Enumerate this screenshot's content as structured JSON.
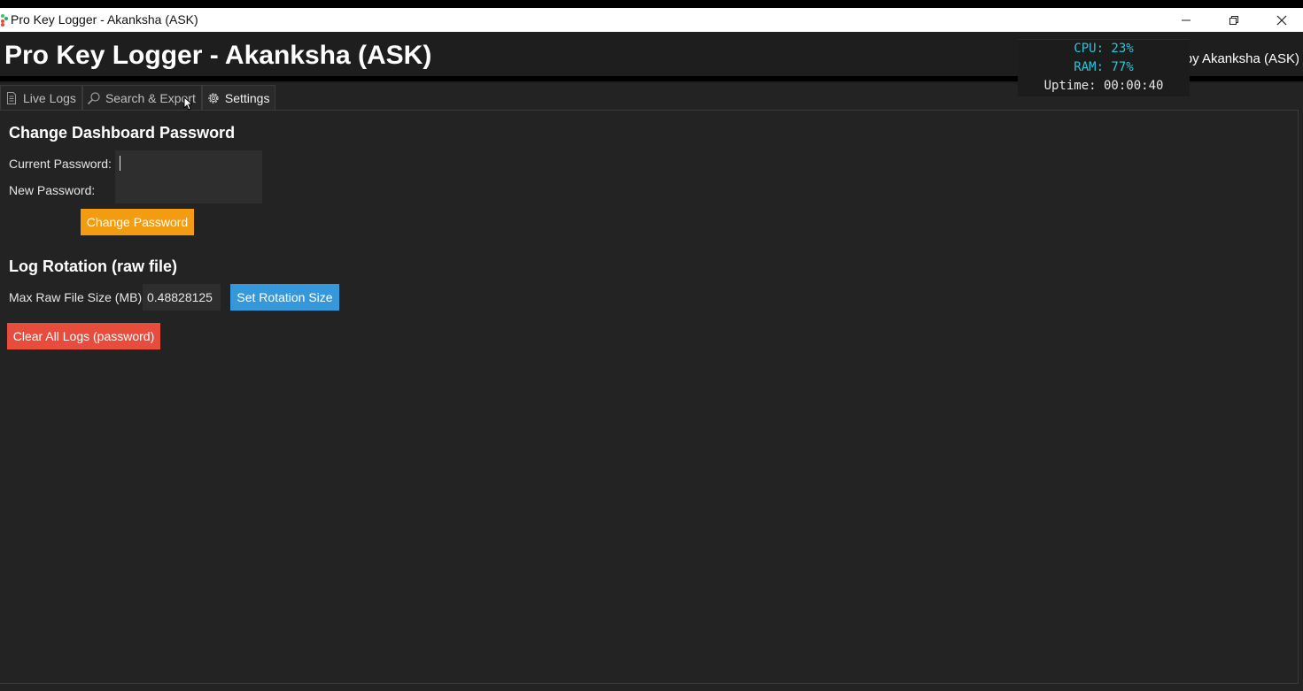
{
  "window": {
    "title": "Pro Key Logger - Akanksha (ASK)",
    "minimize_icon": "minimize-icon",
    "maximize_icon": "restore-icon",
    "close_icon": "close-icon"
  },
  "header": {
    "title": "Pro Key Logger - Akanksha (ASK)",
    "credit": "by Akanksha (ASK)"
  },
  "stats": {
    "cpu": "CPU: 23%",
    "ram": "RAM: 77%",
    "uptime": "Uptime: 00:00:40",
    "accent_color": "#2ec4d6"
  },
  "tabs": [
    {
      "label": "Live Logs",
      "icon": "document-icon",
      "active": false
    },
    {
      "label": "Search & Export",
      "icon": "search-icon",
      "active": false
    },
    {
      "label": "Settings",
      "icon": "gear-icon",
      "active": true
    }
  ],
  "password_section": {
    "title": "Change Dashboard Password",
    "current_label": "Current Password:",
    "current_value": "",
    "new_label": "New Password:",
    "new_value": "",
    "button_label": "Change Password",
    "button_color": "#f39c12"
  },
  "rotation_section": {
    "title": "Log Rotation (raw file)",
    "size_label": "Max Raw File Size (MB):",
    "size_value": "0.48828125",
    "button_label": "Set Rotation Size",
    "button_color": "#3498db"
  },
  "clear": {
    "button_label": "Clear All Logs (password)",
    "button_color": "#e74c3c"
  }
}
